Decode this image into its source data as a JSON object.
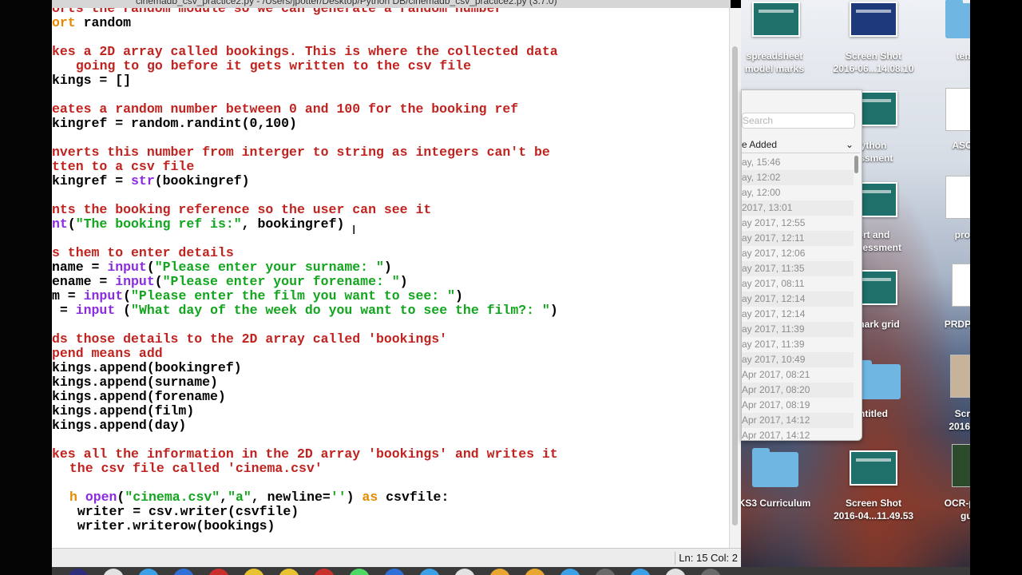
{
  "window": {
    "title": "cinemadb_csv_practice2.py - /Users/jpotter/Desktop/Python DB/cinemadb_csv_practice2.py (3.7.0)"
  },
  "code_lines": [
    [
      {
        "c": "cm",
        "t": "orts the random module so we can generate a random number"
      }
    ],
    [
      {
        "c": "kw",
        "t": "ort"
      },
      {
        "c": "",
        "t": " random"
      }
    ],
    [],
    [
      {
        "c": "cm",
        "t": "kes a 2D array called bookings. This is where the collected data"
      }
    ],
    [
      {
        "c": "cm",
        "t": " going to go before it gets written to the csv file"
      }
    ],
    [
      {
        "c": "",
        "t": "kings = []"
      }
    ],
    [],
    [
      {
        "c": "cm",
        "t": "eates a random number between 0 and 100 for the booking ref"
      }
    ],
    [
      {
        "c": "",
        "t": "kingref = random.randint(0,100)"
      }
    ],
    [],
    [
      {
        "c": "cm",
        "t": "nverts this number from interger to string as integers can't be"
      }
    ],
    [
      {
        "c": "cm",
        "t": "tten to a csv file"
      }
    ],
    [
      {
        "c": "",
        "t": "kingref = "
      },
      {
        "c": "bi",
        "t": "str"
      },
      {
        "c": "",
        "t": "(bookingref)"
      }
    ],
    [],
    [
      {
        "c": "cm",
        "t": "nts the booking reference so the user can see it"
      }
    ],
    [
      {
        "c": "bi",
        "t": "nt"
      },
      {
        "c": "",
        "t": "("
      },
      {
        "c": "st",
        "t": "\"The booking ref is:\""
      },
      {
        "c": "",
        "t": ", bookingref)"
      }
    ],
    [],
    [
      {
        "c": "cm",
        "t": "s them to enter details"
      }
    ],
    [
      {
        "c": "",
        "t": "name = "
      },
      {
        "c": "bi",
        "t": "input"
      },
      {
        "c": "",
        "t": "("
      },
      {
        "c": "st",
        "t": "\"Please enter your surname: \""
      },
      {
        "c": "",
        "t": ")"
      }
    ],
    [
      {
        "c": "",
        "t": "ename = "
      },
      {
        "c": "bi",
        "t": "input"
      },
      {
        "c": "",
        "t": "("
      },
      {
        "c": "st",
        "t": "\"Please enter your forename: \""
      },
      {
        "c": "",
        "t": ")"
      }
    ],
    [
      {
        "c": "",
        "t": "m = "
      },
      {
        "c": "bi",
        "t": "input"
      },
      {
        "c": "",
        "t": "("
      },
      {
        "c": "st",
        "t": "\"Please enter the film you want to see: \""
      },
      {
        "c": "",
        "t": ")"
      }
    ],
    [
      {
        "c": "",
        "t": " = "
      },
      {
        "c": "bi",
        "t": "input"
      },
      {
        "c": "",
        "t": " ("
      },
      {
        "c": "st",
        "t": "\"What day of the week do you want to see the film?: \""
      },
      {
        "c": "",
        "t": ")"
      }
    ],
    [],
    [
      {
        "c": "cm",
        "t": "ds those details to the 2D array called 'bookings'"
      }
    ],
    [
      {
        "c": "cm",
        "t": "pend means add"
      }
    ],
    [
      {
        "c": "",
        "t": "kings.append(bookingref)"
      }
    ],
    [
      {
        "c": "",
        "t": "kings.append(surname)"
      }
    ],
    [
      {
        "c": "",
        "t": "kings.append(forename)"
      }
    ],
    [
      {
        "c": "",
        "t": "kings.append(film)"
      }
    ],
    [
      {
        "c": "",
        "t": "kings.append(day)"
      }
    ],
    [],
    [
      {
        "c": "cm",
        "t": "kes all the information in the 2D array 'bookings' and writes it"
      }
    ],
    [
      {
        "c": "cm",
        "t": " the csv file called 'cinema.csv'"
      }
    ],
    [],
    [
      {
        "c": "kw",
        "t": "h"
      },
      {
        "c": "",
        "t": " "
      },
      {
        "c": "bi",
        "t": "open"
      },
      {
        "c": "",
        "t": "("
      },
      {
        "c": "st",
        "t": "\"cinema.csv\""
      },
      {
        "c": "",
        "t": ","
      },
      {
        "c": "st",
        "t": "\"a\""
      },
      {
        "c": "",
        "t": ", newline="
      },
      {
        "c": "st",
        "t": "''"
      },
      {
        "c": "",
        "t": ") "
      },
      {
        "c": "kw",
        "t": "as"
      },
      {
        "c": "",
        "t": " csvfile:"
      }
    ],
    [
      {
        "c": "",
        "t": " writer = csv.writer(csvfile)"
      }
    ],
    [
      {
        "c": "",
        "t": " writer.writerow(bookings)"
      }
    ]
  ],
  "status": {
    "position": "Ln: 15 Col: 2"
  },
  "desktop_icons": [
    {
      "label1": "spreadsheet",
      "label2": "model marks"
    },
    {
      "label1": "Screen Shot",
      "label2": "2016-06...14.08.10"
    },
    {
      "label1": "temp",
      "label2": ""
    },
    {
      "label1": "ython",
      "label2": "essment"
    },
    {
      "label1": "ASCII f",
      "label2": ""
    },
    {
      "label1": "ort and",
      "label2": "nt...essment"
    },
    {
      "label1": "proce",
      "label2": ""
    },
    {
      "label1": "h mark grid",
      "label2": ""
    },
    {
      "label1": "PRDP Pap",
      "label2": ""
    },
    {
      "label1": "ntitled",
      "label2": ""
    },
    {
      "label1": "Scree",
      "label2": "2016-06."
    },
    {
      "label1": "KS3 Curriculum",
      "label2": ""
    },
    {
      "label1": "Screen Shot",
      "label2": "2016-04...11.49.53"
    },
    {
      "label1": "OCR-pseu",
      "label2": "gui"
    }
  ],
  "finder": {
    "search_placeholder": "Search",
    "sort_label": "e Added",
    "rows": [
      "ay, 15:46",
      "ay, 12:02",
      "ay, 12:00",
      "2017, 13:01",
      "ay 2017, 12:55",
      "ay 2017, 12:11",
      "ay 2017, 12:06",
      "ay 2017, 11:35",
      "ay 2017, 08:11",
      "ay 2017, 12:14",
      "ay 2017, 12:14",
      "ay 2017, 11:39",
      "ay 2017, 11:39",
      "ay 2017, 10:49",
      "Apr 2017, 08:21",
      "Apr 2017, 08:20",
      "Apr 2017, 08:19",
      "Apr 2017, 14:12",
      "Apr 2017, 14:12"
    ]
  },
  "colors": {
    "comment": "#c0231f",
    "keyword": "#e68a00",
    "builtin": "#8a2be2",
    "string": "#12a51e"
  }
}
